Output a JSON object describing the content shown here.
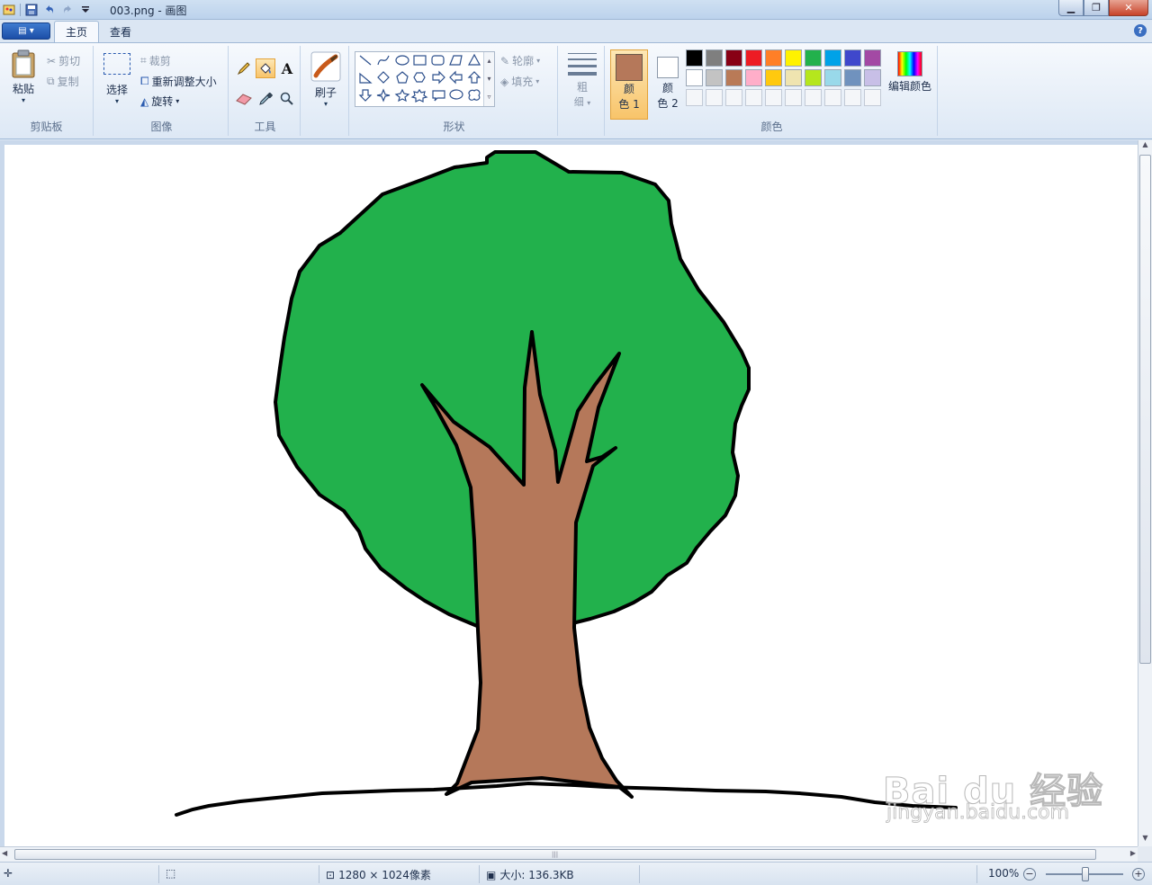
{
  "window": {
    "title": "003.png - 画图",
    "buttons": {
      "minimize": "minimize",
      "maximize": "restore",
      "close": "close"
    }
  },
  "tabs": [
    {
      "label": "主页",
      "active": true
    },
    {
      "label": "查看",
      "active": false
    }
  ],
  "ribbon": {
    "clipboard": {
      "paste": "粘贴",
      "cut": "剪切",
      "copy": "复制",
      "group": "剪贴板"
    },
    "image": {
      "select": "选择",
      "crop": "裁剪",
      "resize": "重新调整大小",
      "rotate": "旋转",
      "group": "图像"
    },
    "tools": {
      "group": "工具"
    },
    "brushes": {
      "label": "刷子"
    },
    "shapes": {
      "outline": "轮廓",
      "fill": "填充",
      "group": "形状"
    },
    "size": {
      "label_top": "粗",
      "label_bottom": "细"
    },
    "colors": {
      "color1_top": "颜",
      "color1_bottom": "色 1",
      "color2_top": "颜",
      "color2_bottom": "色 2",
      "edit": "编辑颜色",
      "group": "颜色",
      "color1_value": "#b5785a",
      "color2_value": "#ffffff",
      "row1": [
        "#000000",
        "#7f7f7f",
        "#880015",
        "#ed1c24",
        "#ff7f27",
        "#fff200",
        "#22b14c",
        "#00a2e8",
        "#3f48cc",
        "#a349a4"
      ],
      "row2": [
        "#ffffff",
        "#c3c3c3",
        "#b97a57",
        "#ffaec9",
        "#ffc90e",
        "#efe4b0",
        "#b5e61d",
        "#99d9ea",
        "#7092be",
        "#c8bfe7"
      ]
    }
  },
  "canvas": {
    "colors": {
      "foliage": "#22b14c",
      "trunk": "#b5785a",
      "outline": "#000000"
    },
    "watermark": {
      "brand": "Bai du 经验",
      "url": "jingyan.baidu.com"
    }
  },
  "status": {
    "dimensions": "1280 × 1024像素",
    "size": "大小: 136.3KB",
    "zoom": "100%"
  }
}
